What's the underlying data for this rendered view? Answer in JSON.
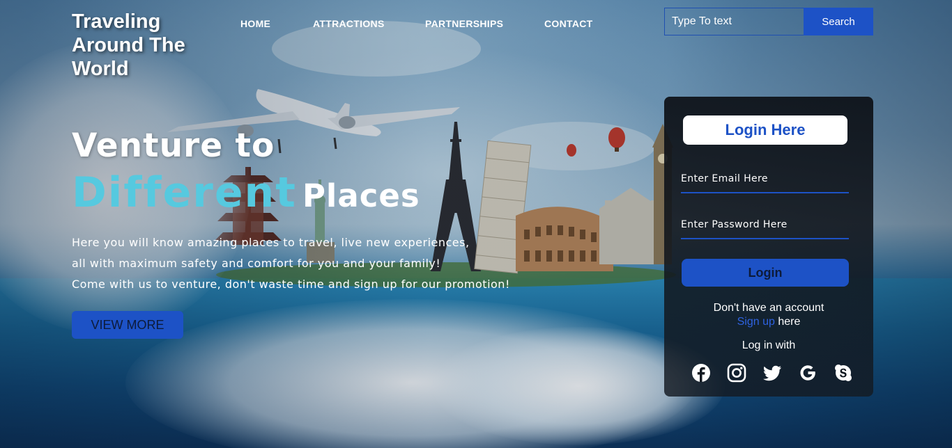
{
  "brand": {
    "title": "Traveling Around The World"
  },
  "nav": {
    "items": [
      {
        "label": "HOME"
      },
      {
        "label": "ATTRACTIONS"
      },
      {
        "label": "PARTNERSHIPS"
      },
      {
        "label": "CONTACT"
      }
    ]
  },
  "search": {
    "placeholder": "Type To text",
    "button_label": "Search"
  },
  "hero": {
    "title_line1": "Venture to",
    "title_accent": "Different",
    "title_rest": "Places",
    "paragraph_lines": [
      "Here you will know amazing places to travel, live new experiences,",
      "all with maximum safety and comfort for you and your family!",
      "Come with us to venture, don't waste time and sign up for our promotion!"
    ],
    "cta_label": "VIEW MORE"
  },
  "login": {
    "heading": "Login Here",
    "email_placeholder": "Enter Email Here",
    "password_placeholder": "Enter Password Here",
    "button_label": "Login",
    "no_account_text": "Don't have an account",
    "signup_link": "Sign up",
    "signup_suffix": " here",
    "login_with_text": "Log in with",
    "social_icons": [
      "facebook-icon",
      "instagram-icon",
      "twitter-icon",
      "google-icon",
      "skype-icon"
    ]
  },
  "colors": {
    "accent_blue": "#1d52c6",
    "accent_cyan": "#56c9df",
    "card_background": "#0d1117",
    "link_blue": "#2e62e0"
  }
}
